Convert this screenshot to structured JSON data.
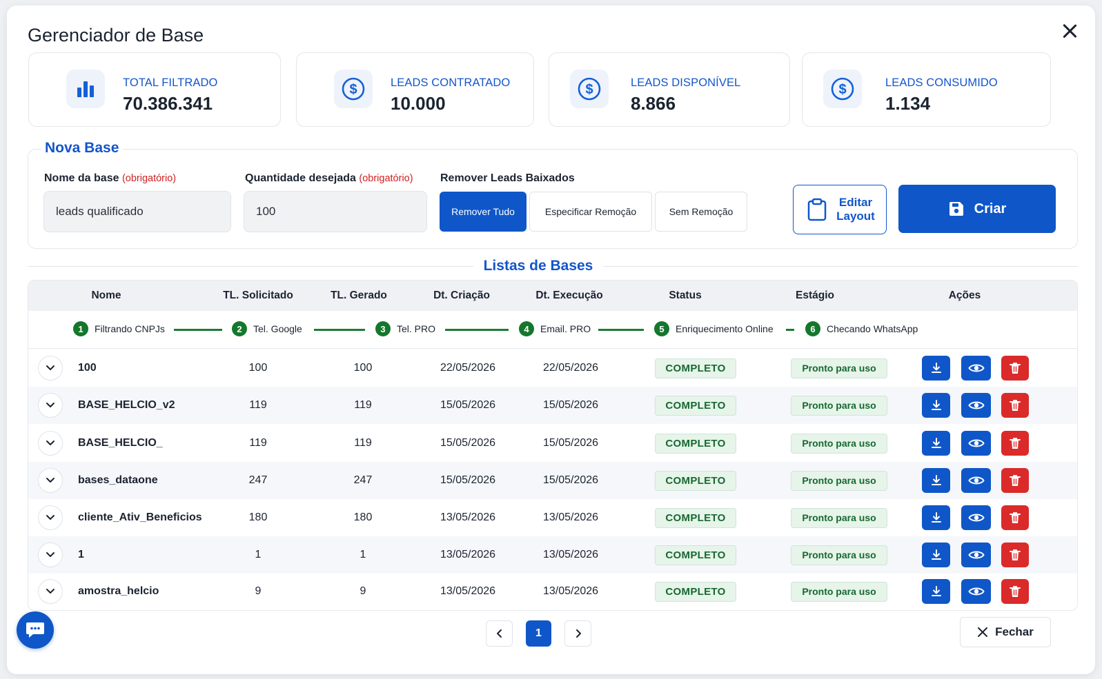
{
  "header": {
    "title": "Gerenciador de Base"
  },
  "stats": [
    {
      "label": "TOTAL FILTRADO",
      "value": "70.386.341",
      "icon": "bar-chart-icon"
    },
    {
      "label": "LEADS CONTRATADO",
      "value": "10.000",
      "icon": "dollar-icon"
    },
    {
      "label": "LEADS DISPONÍVEL",
      "value": "8.866",
      "icon": "dollar-icon"
    },
    {
      "label": "LEADS CONSUMIDO",
      "value": "1.134",
      "icon": "dollar-icon"
    }
  ],
  "nova_base": {
    "title": "Nova Base",
    "nome_label": "Nome da base",
    "nome_required": "(obrigatório)",
    "nome_value": "leads qualificado",
    "qtd_label": "Quantidade desejada",
    "qtd_required": "(obrigatório)",
    "qtd_value": "100",
    "remover_label": "Remover Leads Baixados",
    "remover_options": [
      "Remover Tudo",
      "Especificar Remoção",
      "Sem Remoção"
    ],
    "remover_selected": "Remover Tudo",
    "editar_layout": "Editar Layout",
    "criar": "Criar"
  },
  "lista": {
    "title": "Listas de Bases",
    "columns": [
      "Nome",
      "TL. Solicitado",
      "TL. Gerado",
      "Dt. Criação",
      "Dt. Execução",
      "Status",
      "Estágio",
      "Ações"
    ],
    "stages": [
      {
        "num": "1",
        "label": "Filtrando CNPJs"
      },
      {
        "num": "2",
        "label": "Tel. Google"
      },
      {
        "num": "3",
        "label": "Tel. PRO"
      },
      {
        "num": "4",
        "label": "Email. PRO"
      },
      {
        "num": "5",
        "label": "Enriquecimento Online"
      },
      {
        "num": "6",
        "label": "Checando WhatsApp"
      }
    ],
    "rows": [
      {
        "nome": "100",
        "solicitado": "100",
        "gerado": "100",
        "criacao": "22/05/2026",
        "execucao": "22/05/2026",
        "status": "COMPLETO",
        "estagio": "Pronto para uso"
      },
      {
        "nome": "BASE_HELCIO_v2",
        "solicitado": "119",
        "gerado": "119",
        "criacao": "15/05/2026",
        "execucao": "15/05/2026",
        "status": "COMPLETO",
        "estagio": "Pronto para uso"
      },
      {
        "nome": "BASE_HELCIO_",
        "solicitado": "119",
        "gerado": "119",
        "criacao": "15/05/2026",
        "execucao": "15/05/2026",
        "status": "COMPLETO",
        "estagio": "Pronto para uso"
      },
      {
        "nome": "bases_dataone",
        "solicitado": "247",
        "gerado": "247",
        "criacao": "15/05/2026",
        "execucao": "15/05/2026",
        "status": "COMPLETO",
        "estagio": "Pronto para uso"
      },
      {
        "nome": "cliente_Ativ_Beneficios",
        "solicitado": "180",
        "gerado": "180",
        "criacao": "13/05/2026",
        "execucao": "13/05/2026",
        "status": "COMPLETO",
        "estagio": "Pronto para uso"
      },
      {
        "nome": "1",
        "solicitado": "1",
        "gerado": "1",
        "criacao": "13/05/2026",
        "execucao": "13/05/2026",
        "status": "COMPLETO",
        "estagio": "Pronto para uso"
      },
      {
        "nome": "amostra_helcio",
        "solicitado": "9",
        "gerado": "9",
        "criacao": "13/05/2026",
        "execucao": "13/05/2026",
        "status": "COMPLETO",
        "estagio": "Pronto para uso"
      }
    ]
  },
  "pagination": {
    "current": "1"
  },
  "footer": {
    "fechar": "Fechar"
  },
  "colors": {
    "primary": "#0f57c8",
    "success": "#17682f",
    "danger": "#db2a2a"
  }
}
